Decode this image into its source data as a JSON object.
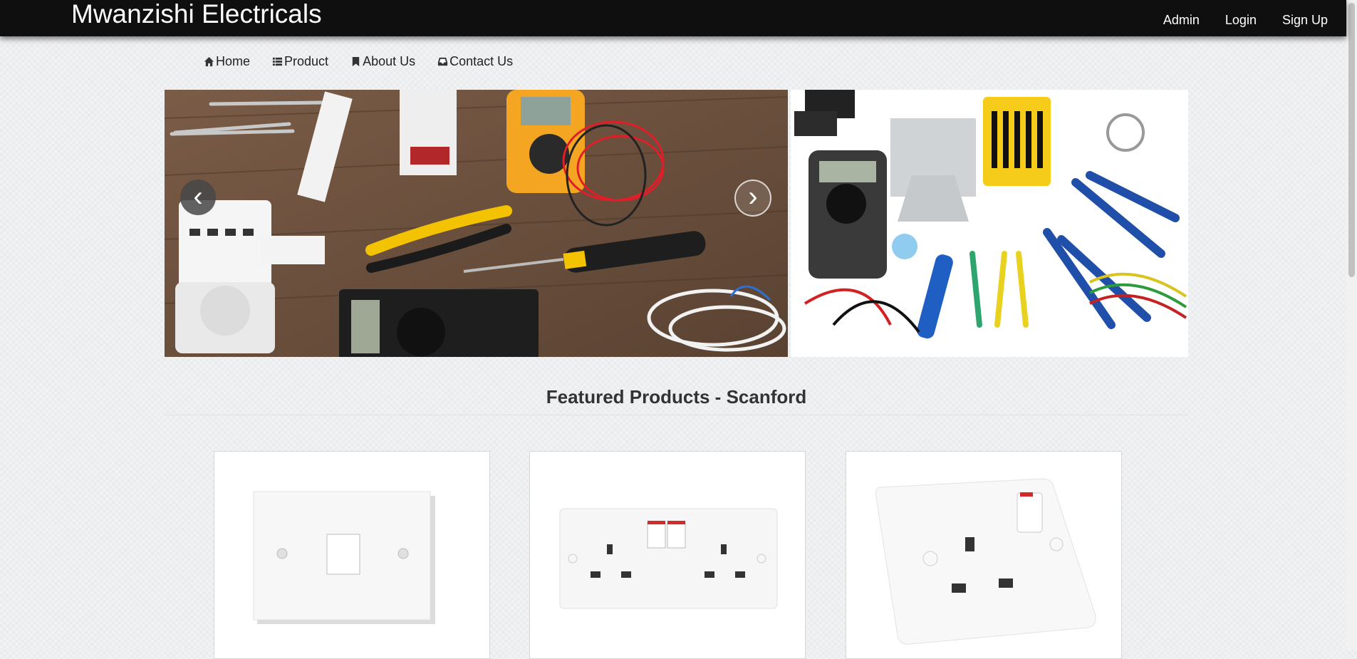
{
  "header": {
    "brand": "Mwanzishi Electricals",
    "links": [
      "Admin",
      "Login",
      "Sign Up"
    ]
  },
  "nav": {
    "items": [
      {
        "label": "Home",
        "icon": "home-icon"
      },
      {
        "label": "Product",
        "icon": "list-icon"
      },
      {
        "label": "About Us",
        "icon": "bookmark-icon"
      },
      {
        "label": "Contact Us",
        "icon": "inbox-icon"
      }
    ]
  },
  "carousel": {
    "prev": "‹",
    "next": "›"
  },
  "featured": {
    "title": "Featured Products - Scanford"
  },
  "colors": {
    "topbar": "#0f0f0f",
    "page_bg": "#f1f2f4"
  }
}
